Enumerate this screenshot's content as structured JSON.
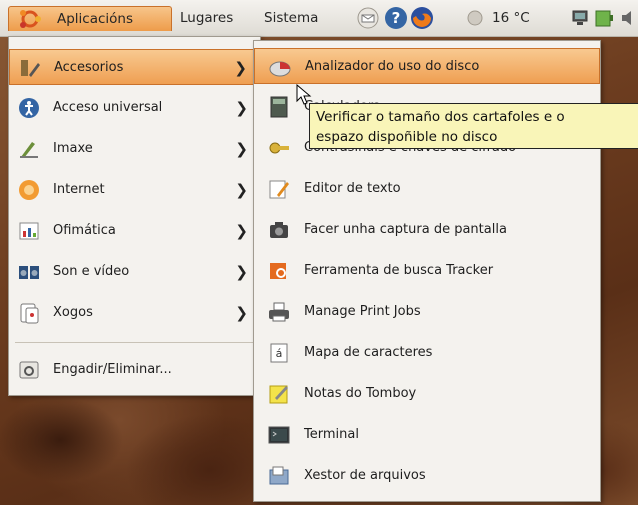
{
  "panel": {
    "applications_label": "Aplicacións",
    "places_label": "Lugares",
    "system_label": "Sistema",
    "temperature": "16 °C"
  },
  "main_menu": {
    "items": [
      {
        "label": "Accesorios",
        "icon": "accessories-icon",
        "submenu": true,
        "highlighted": true
      },
      {
        "label": "Acceso universal",
        "icon": "universal-access-icon",
        "submenu": true
      },
      {
        "label": "Imaxe",
        "icon": "graphics-icon",
        "submenu": true
      },
      {
        "label": "Internet",
        "icon": "internet-icon",
        "submenu": true
      },
      {
        "label": "Ofimática",
        "icon": "office-icon",
        "submenu": true
      },
      {
        "label": "Son e vídeo",
        "icon": "sound-video-icon",
        "submenu": true
      },
      {
        "label": "Xogos",
        "icon": "games-icon",
        "submenu": true
      }
    ],
    "footer_item": {
      "label": "Engadir/Eliminar...",
      "icon": "add-remove-icon"
    }
  },
  "sub_menu": {
    "items": [
      {
        "label": "Analizador do uso do disco",
        "icon": "disk-usage-icon",
        "highlighted": true
      },
      {
        "label": "Calculadora",
        "icon": "calculator-icon"
      },
      {
        "label": "Contrasinais e chaves de cifrado",
        "icon": "passwords-icon"
      },
      {
        "label": "Editor de texto",
        "icon": "text-editor-icon"
      },
      {
        "label": "Facer unha captura de pantalla",
        "icon": "screenshot-icon"
      },
      {
        "label": "Ferramenta de busca Tracker",
        "icon": "search-tool-icon"
      },
      {
        "label": "Manage Print Jobs",
        "icon": "printer-icon"
      },
      {
        "label": "Mapa de caracteres",
        "icon": "charmap-icon"
      },
      {
        "label": "Notas do Tomboy",
        "icon": "notes-icon"
      },
      {
        "label": "Terminal",
        "icon": "terminal-icon"
      },
      {
        "label": "Xestor de arquivos",
        "icon": "file-manager-icon"
      }
    ]
  },
  "tooltip": {
    "line1": "Verificar o tamaño dos cartafoles e o",
    "line2": "espazo dispoñible no disco"
  },
  "colors": {
    "highlight": "#ef9f52",
    "menu_bg": "#f4f2ee",
    "tooltip_bg": "#f9f5b8"
  }
}
